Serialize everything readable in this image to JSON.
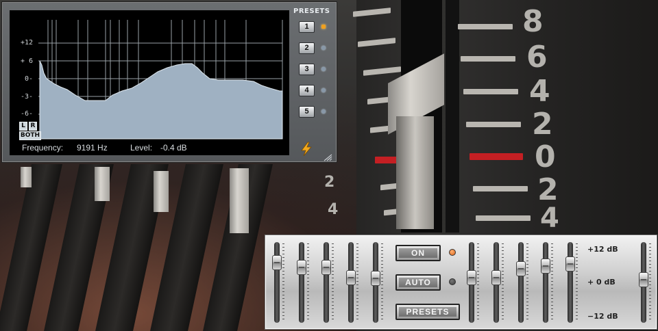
{
  "analyzer": {
    "y_labels": [
      "+12",
      "+ 6",
      "0-",
      "-3-",
      "-6-"
    ],
    "channels": {
      "left": "L",
      "right": "R",
      "both": "BOTH"
    },
    "status": {
      "frequency_label": "Frequency:",
      "frequency_value": "9191 Hz",
      "level_label": "Level:",
      "level_value": "-0.4 dB"
    },
    "presets_title": "PRESETS",
    "presets": [
      {
        "label": "1",
        "active": true
      },
      {
        "label": "2",
        "active": false
      },
      {
        "label": "3",
        "active": false
      },
      {
        "label": "4",
        "active": false
      },
      {
        "label": "5",
        "active": false
      }
    ],
    "icons": {
      "lightning": "lightning-icon",
      "resize": "resize-grip-icon"
    },
    "colors": {
      "spectrum_fill": "#9fb1c2",
      "grid": "#9aa2a8",
      "background": "#000000"
    }
  },
  "equalizer": {
    "buttons": {
      "on": "ON",
      "auto": "AUTO",
      "presets": "PRESETS"
    },
    "indicators": {
      "on_led": "#d9621a",
      "auto_led": "#3d3d3d"
    },
    "scale": {
      "top": "+12 dB",
      "middle": "+ 0 dB",
      "bottom": "−12 dB"
    },
    "left_bands": [
      0.6,
      0.45,
      0.45,
      0.15,
      0.12
    ],
    "right_bands": [
      0.15,
      0.15,
      0.4,
      0.5,
      0.55
    ],
    "output": 0.08
  },
  "background_scale": [
    "8",
    "6",
    "4",
    "2",
    "0",
    "2",
    "4"
  ],
  "background_scale_left": [
    "2",
    "4"
  ]
}
